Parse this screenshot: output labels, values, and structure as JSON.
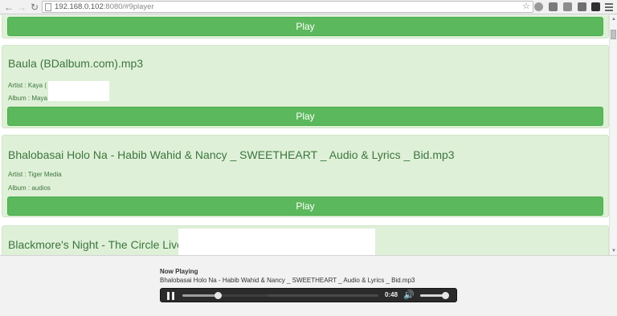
{
  "browser": {
    "url_host": "192.168.0.102",
    "url_rest": ":8080/#9player"
  },
  "songs": [
    {
      "play_label": "Play"
    },
    {
      "title": "Baula (BDalbum.com).mp3",
      "artist": "Artist : Kaya (",
      "album": "Album : Maya",
      "play_label": "Play"
    },
    {
      "title": "Bhalobasai Holo Na - Habib Wahid & Nancy _ SWEETHEART _ Audio & Lyrics _ Bid.mp3",
      "artist": "Artist : Tiger Media",
      "album": "Album : audios",
      "play_label": "Play"
    },
    {
      "title": "Blackmore's Night - The Circle Live"
    }
  ],
  "player": {
    "heading": "Now Playing",
    "track": "Bhalobasai Holo Na - Habib Wahid & Nancy _ SWEETHEART _ Audio & Lyrics _ Bid.mp3",
    "time": "0:48",
    "progress_fraction": 0.18,
    "buffered_fraction": 0.44,
    "volume_fraction": 0.9
  },
  "icons": {
    "back": "back-arrow-icon",
    "forward": "forward-arrow-icon",
    "reload": "reload-icon",
    "bookmark": "star-icon",
    "pause": "pause-icon",
    "volume": "speaker-icon",
    "menu": "hamburger-menu-icon"
  },
  "colors": {
    "card_bg": "#dff0d8",
    "title_text": "#3c763d",
    "play_button": "#5cb85c",
    "player_bar": "#2b2b2b"
  }
}
